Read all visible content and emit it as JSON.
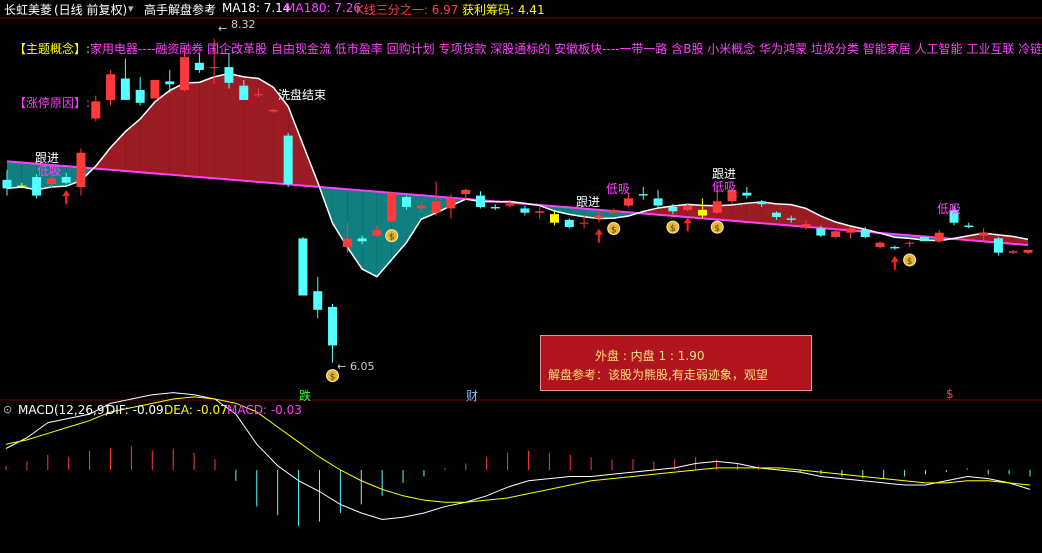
{
  "header": {
    "stock_name": "长虹美菱",
    "period": "(日线 前复权)",
    "indicator": "高手解盘参考",
    "ma18": "MA18: 7.14",
    "ma180": "MA180: 7.26",
    "kline": "K线三分之一: 6.97",
    "profit_chips": "获利筹码: 4.41"
  },
  "concept": {
    "label": "【主题概念】:",
    "text": "家用电器----融资融券 国企改革股 自由现金流 低市盈率 回购计划 专项贷款 深股通标的 安徽板块----一带一路 含B股 小米概念 华为鸿蒙 垃圾分类 智能家居 人工智能 工业互联 冷链物流"
  },
  "limit_reason": "【涨停原因】:",
  "annotations": {
    "high": "8.32",
    "low": "6.05",
    "washout": "洗盘结束",
    "follow": "跟进",
    "buy_low": "低吸",
    "die": "跌",
    "cai": "财",
    "dollar": "$"
  },
  "infobox": {
    "line1": "外盘 : 内盘   1  :  1.90",
    "line2": "解盘参考：该股为熊股,有走弱迹象，观望"
  },
  "macd": {
    "title": "MACD(12,26,9)",
    "dif": "DIF: -0.09",
    "dea": "DEA: -0.07",
    "macd": "MACD: -0.03"
  },
  "colors": {
    "up": "#ff3a3a",
    "down": "#54ffff",
    "yellow": "#ffff00",
    "ma180": "#ff40ff",
    "ma18": "#ffffff",
    "cloud_bull": "#9c1c24",
    "cloud_bear": "#0f7f7f"
  },
  "chart_data": {
    "type": "candlestick",
    "ylim": [
      5.9,
      8.45
    ],
    "candles": [
      {
        "o": 7.33,
        "h": 7.4,
        "l": 7.22,
        "c": 7.27
      },
      {
        "o": 7.29,
        "h": 7.31,
        "l": 7.27,
        "c": 7.29
      },
      {
        "o": 7.35,
        "h": 7.37,
        "l": 7.2,
        "c": 7.22
      },
      {
        "o": 7.3,
        "h": 7.39,
        "l": 7.27,
        "c": 7.34
      },
      {
        "o": 7.35,
        "h": 7.38,
        "l": 7.3,
        "c": 7.31
      },
      {
        "o": 7.28,
        "h": 7.55,
        "l": 7.22,
        "c": 7.52
      },
      {
        "o": 7.76,
        "h": 7.92,
        "l": 7.74,
        "c": 7.88
      },
      {
        "o": 7.89,
        "h": 8.1,
        "l": 7.85,
        "c": 8.07
      },
      {
        "o": 8.04,
        "h": 8.18,
        "l": 7.94,
        "c": 7.89
      },
      {
        "o": 7.96,
        "h": 8.05,
        "l": 7.85,
        "c": 7.87
      },
      {
        "o": 7.9,
        "h": 8.03,
        "l": 7.95,
        "c": 8.03
      },
      {
        "o": 8.02,
        "h": 8.1,
        "l": 7.94,
        "c": 8.0
      },
      {
        "o": 7.96,
        "h": 8.25,
        "l": 7.95,
        "c": 8.19
      },
      {
        "o": 8.15,
        "h": 8.22,
        "l": 8.08,
        "c": 8.1
      },
      {
        "o": 8.12,
        "h": 8.32,
        "l": 8.0,
        "c": 8.12
      },
      {
        "o": 8.12,
        "h": 8.22,
        "l": 7.97,
        "c": 8.01
      },
      {
        "o": 7.99,
        "h": 8.03,
        "l": 7.89,
        "c": 7.89
      },
      {
        "o": 7.93,
        "h": 7.97,
        "l": 7.91,
        "c": 7.93
      },
      {
        "o": 7.81,
        "h": 7.83,
        "l": 7.8,
        "c": 7.82
      },
      {
        "o": 7.64,
        "h": 7.66,
        "l": 7.28,
        "c": 7.3
      },
      {
        "o": 6.92,
        "h": 6.93,
        "l": 6.52,
        "c": 6.52
      },
      {
        "o": 6.55,
        "h": 6.65,
        "l": 6.36,
        "c": 6.42
      },
      {
        "o": 6.44,
        "h": 6.46,
        "l": 6.05,
        "c": 6.17
      },
      {
        "o": 6.86,
        "h": 7.03,
        "l": 6.82,
        "c": 6.92
      },
      {
        "o": 6.92,
        "h": 6.94,
        "l": 6.88,
        "c": 6.9
      },
      {
        "o": 6.94,
        "h": 7.01,
        "l": 6.93,
        "c": 6.98
      },
      {
        "o": 7.04,
        "h": 7.24,
        "l": 7.03,
        "c": 7.24
      },
      {
        "o": 7.21,
        "h": 7.22,
        "l": 7.12,
        "c": 7.14
      },
      {
        "o": 7.13,
        "h": 7.18,
        "l": 7.1,
        "c": 7.15
      },
      {
        "o": 7.1,
        "h": 7.32,
        "l": 7.08,
        "c": 7.18
      },
      {
        "o": 7.13,
        "h": 7.23,
        "l": 7.06,
        "c": 7.2
      },
      {
        "o": 7.23,
        "h": 7.27,
        "l": 7.19,
        "c": 7.26
      },
      {
        "o": 7.22,
        "h": 7.25,
        "l": 7.13,
        "c": 7.14
      },
      {
        "o": 7.14,
        "h": 7.16,
        "l": 7.12,
        "c": 7.13
      },
      {
        "o": 7.15,
        "h": 7.19,
        "l": 7.14,
        "c": 7.16
      },
      {
        "o": 7.13,
        "h": 7.15,
        "l": 7.08,
        "c": 7.1
      },
      {
        "o": 7.1,
        "h": 7.14,
        "l": 7.06,
        "c": 7.11
      },
      {
        "o": 7.09,
        "h": 7.11,
        "l": 7.01,
        "c": 7.03
      },
      {
        "o": 7.05,
        "h": 7.06,
        "l": 6.99,
        "c": 7.0
      },
      {
        "o": 7.03,
        "h": 7.09,
        "l": 6.99,
        "c": 7.03
      },
      {
        "o": 7.06,
        "h": 7.12,
        "l": 7.03,
        "c": 7.08
      },
      {
        "o": 7.1,
        "h": 7.13,
        "l": 7.08,
        "c": 7.12
      },
      {
        "o": 7.15,
        "h": 7.23,
        "l": 7.14,
        "c": 7.2
      },
      {
        "o": 7.23,
        "h": 7.28,
        "l": 7.19,
        "c": 7.22
      },
      {
        "o": 7.2,
        "h": 7.26,
        "l": 7.14,
        "c": 7.15
      },
      {
        "o": 7.14,
        "h": 7.16,
        "l": 7.09,
        "c": 7.11
      },
      {
        "o": 7.12,
        "h": 7.16,
        "l": 7.11,
        "c": 7.15
      },
      {
        "o": 7.12,
        "h": 7.2,
        "l": 7.06,
        "c": 7.08
      },
      {
        "o": 7.1,
        "h": 7.29,
        "l": 7.09,
        "c": 7.18
      },
      {
        "o": 7.18,
        "h": 7.27,
        "l": 7.16,
        "c": 7.26
      },
      {
        "o": 7.24,
        "h": 7.28,
        "l": 7.2,
        "c": 7.22
      },
      {
        "o": 7.18,
        "h": 7.19,
        "l": 7.14,
        "c": 7.16
      },
      {
        "o": 7.1,
        "h": 7.11,
        "l": 7.05,
        "c": 7.07
      },
      {
        "o": 7.06,
        "h": 7.08,
        "l": 7.03,
        "c": 7.05
      },
      {
        "o": 7.0,
        "h": 7.05,
        "l": 6.98,
        "c": 7.02
      },
      {
        "o": 6.99,
        "h": 7.01,
        "l": 6.93,
        "c": 6.94
      },
      {
        "o": 6.93,
        "h": 6.98,
        "l": 6.92,
        "c": 6.97
      },
      {
        "o": 6.96,
        "h": 7.0,
        "l": 6.92,
        "c": 6.99
      },
      {
        "o": 6.98,
        "h": 7.0,
        "l": 6.92,
        "c": 6.93
      },
      {
        "o": 6.86,
        "h": 6.9,
        "l": 6.85,
        "c": 6.89
      },
      {
        "o": 6.86,
        "h": 6.87,
        "l": 6.84,
        "c": 6.85
      },
      {
        "o": 6.89,
        "h": 6.9,
        "l": 6.86,
        "c": 6.89
      },
      {
        "o": 6.93,
        "h": 6.94,
        "l": 6.91,
        "c": 6.9
      },
      {
        "o": 6.9,
        "h": 6.98,
        "l": 6.89,
        "c": 6.96
      },
      {
        "o": 7.12,
        "h": 7.15,
        "l": 7.01,
        "c": 7.03
      },
      {
        "o": 7.01,
        "h": 7.03,
        "l": 6.99,
        "c": 7.0
      },
      {
        "o": 6.94,
        "h": 6.99,
        "l": 6.9,
        "c": 6.96
      },
      {
        "o": 6.92,
        "h": 6.93,
        "l": 6.8,
        "c": 6.82
      },
      {
        "o": 6.82,
        "h": 6.84,
        "l": 6.81,
        "c": 6.83
      },
      {
        "o": 6.82,
        "h": 6.84,
        "l": 6.81,
        "c": 6.84
      }
    ],
    "signals": [
      {
        "i": 1,
        "type": "follow",
        "color": "yellow"
      },
      {
        "i": 4,
        "type": "arrow"
      },
      {
        "i": 22,
        "type": "money"
      },
      {
        "i": 26,
        "type": "money"
      },
      {
        "i": 37,
        "type": "follow",
        "color": "yellow"
      },
      {
        "i": 40,
        "type": "arrow"
      },
      {
        "i": 41,
        "type": "money"
      },
      {
        "i": 45,
        "type": "money"
      },
      {
        "i": 46,
        "type": "arrow"
      },
      {
        "i": 47,
        "type": "follow",
        "color": "yellow"
      },
      {
        "i": 48,
        "type": "money"
      },
      {
        "i": 60,
        "type": "arrow"
      },
      {
        "i": 61,
        "type": "money"
      }
    ],
    "macd": {
      "dif": [
        0.1,
        0.15,
        0.22,
        0.24,
        0.26,
        0.31,
        0.33,
        0.35,
        0.36,
        0.35,
        0.33,
        0.26,
        0.12,
        0.02,
        -0.05,
        -0.1,
        -0.16,
        -0.2,
        -0.23,
        -0.22,
        -0.2,
        -0.17,
        -0.15,
        -0.12,
        -0.08,
        -0.05,
        -0.04,
        -0.03,
        -0.03,
        -0.02,
        -0.01,
        0.0,
        0.01,
        0.03,
        0.04,
        0.03,
        0.01,
        0.0,
        -0.01,
        -0.03,
        -0.04,
        -0.05,
        -0.06,
        -0.07,
        -0.07,
        -0.05,
        -0.03,
        -0.04,
        -0.06,
        -0.09
      ],
      "dea": [
        0.12,
        0.14,
        0.17,
        0.2,
        0.23,
        0.27,
        0.29,
        0.31,
        0.33,
        0.34,
        0.33,
        0.31,
        0.27,
        0.2,
        0.13,
        0.06,
        0.0,
        -0.05,
        -0.09,
        -0.12,
        -0.14,
        -0.15,
        -0.15,
        -0.14,
        -0.13,
        -0.11,
        -0.09,
        -0.07,
        -0.05,
        -0.04,
        -0.03,
        -0.02,
        -0.01,
        0.0,
        0.01,
        0.01,
        0.01,
        0.01,
        0.0,
        -0.01,
        -0.02,
        -0.03,
        -0.04,
        -0.05,
        -0.06,
        -0.06,
        -0.05,
        -0.05,
        -0.06,
        -0.07
      ],
      "bars": [
        0.02,
        0.04,
        0.07,
        0.06,
        0.09,
        0.1,
        0.11,
        0.09,
        0.1,
        0.08,
        0.05,
        -0.05,
        -0.17,
        -0.21,
        -0.26,
        -0.24,
        -0.2,
        -0.16,
        -0.12,
        -0.06,
        -0.03,
        0.01,
        0.03,
        0.06,
        0.08,
        0.09,
        0.08,
        0.07,
        0.06,
        0.05,
        0.05,
        0.04,
        0.05,
        0.06,
        0.05,
        0.03,
        0.02,
        0.01,
        -0.01,
        -0.02,
        -0.03,
        -0.04,
        -0.04,
        -0.03,
        -0.02,
        -0.01,
        0.01,
        -0.02,
        -0.02,
        -0.03
      ]
    }
  }
}
